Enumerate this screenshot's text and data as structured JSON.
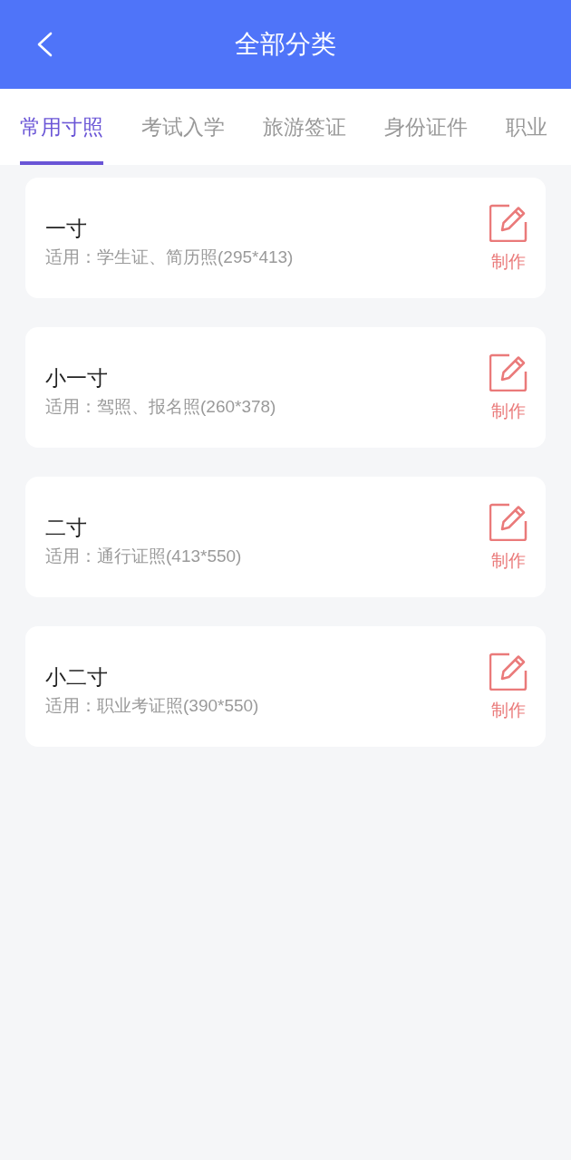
{
  "header": {
    "title": "全部分类"
  },
  "tabs": [
    {
      "label": "常用寸照",
      "selected": true
    },
    {
      "label": "考试入学",
      "selected": false
    },
    {
      "label": "旅游签证",
      "selected": false
    },
    {
      "label": "身份证件",
      "selected": false
    },
    {
      "label": "职业",
      "selected": false
    }
  ],
  "cards": [
    {
      "title": "一寸",
      "subtitle": "适用：学生证、简历照(295*413)",
      "action": "制作"
    },
    {
      "title": "小一寸",
      "subtitle": "适用：驾照、报名照(260*378)",
      "action": "制作"
    },
    {
      "title": "二寸",
      "subtitle": "适用：通行证照(413*550)",
      "action": "制作"
    },
    {
      "title": "小二寸",
      "subtitle": "适用：职业考证照(390*550)",
      "action": "制作"
    }
  ]
}
